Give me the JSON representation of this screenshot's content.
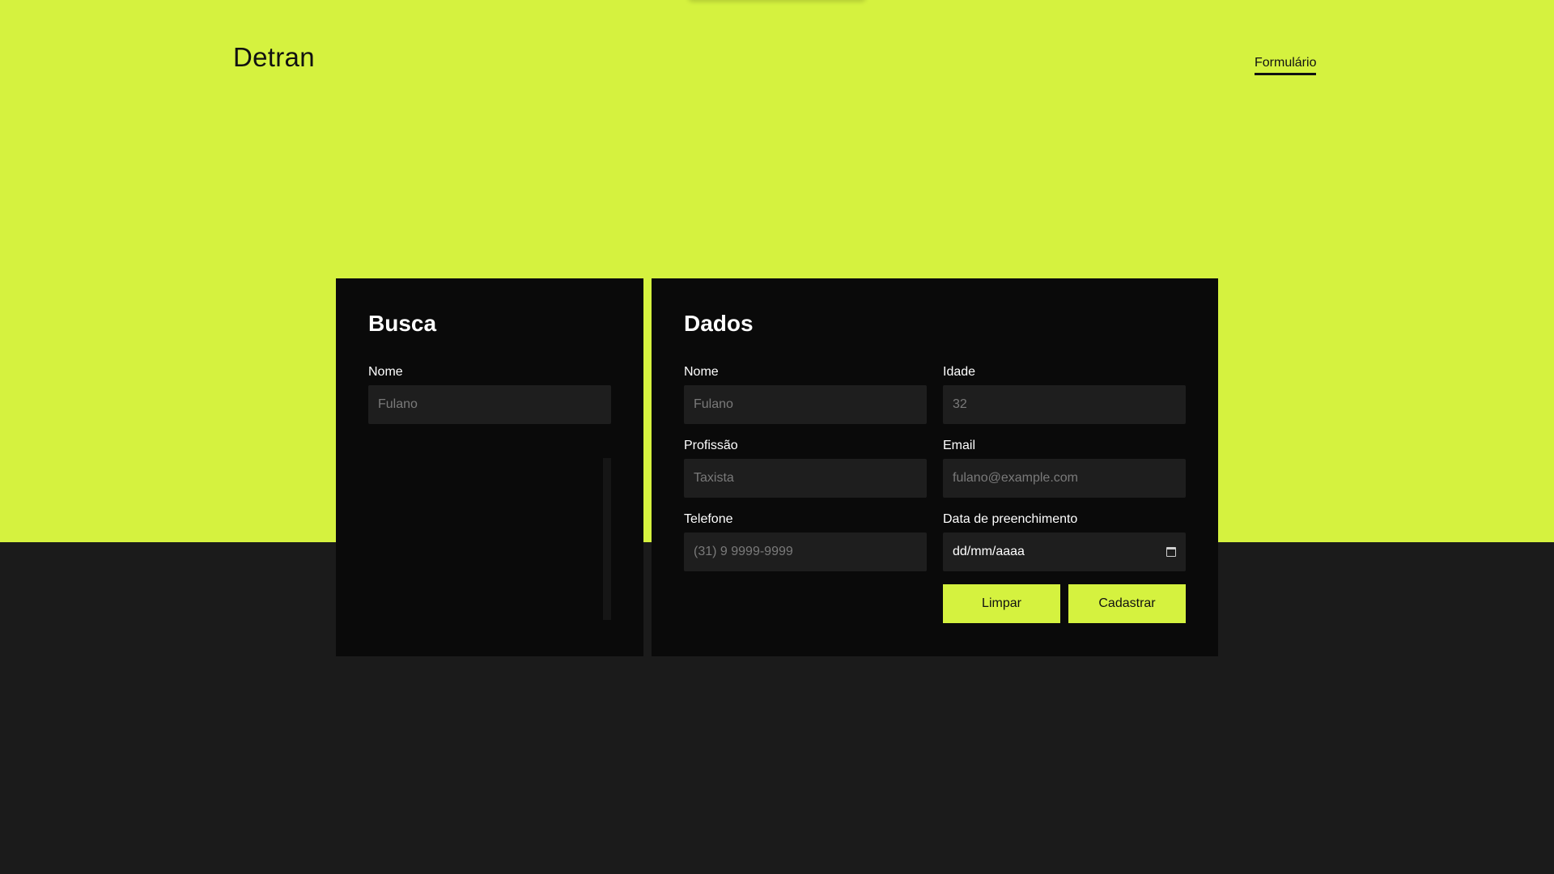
{
  "header": {
    "brand": "Detran",
    "nav_link": "Formulário"
  },
  "busca": {
    "title": "Busca",
    "nome_label": "Nome",
    "nome_placeholder": "Fulano"
  },
  "dados": {
    "title": "Dados",
    "nome_label": "Nome",
    "nome_placeholder": "Fulano",
    "idade_label": "Idade",
    "idade_placeholder": "32",
    "profissao_label": "Profissão",
    "profissao_placeholder": "Taxista",
    "email_label": "Email",
    "email_placeholder": "fulano@example.com",
    "telefone_label": "Telefone",
    "telefone_placeholder": "(31) 9 9999-9999",
    "data_label": "Data de preenchimento",
    "data_value": "dd/mm/aaaa",
    "data_icon": "calendar-icon"
  },
  "buttons": {
    "limpar": "Limpar",
    "cadastrar": "Cadastrar"
  },
  "colors": {
    "accent": "#d5f23f",
    "panel": "#0a0a0a",
    "input": "#1e1e1e",
    "dark_background": "#1b1b1b"
  }
}
